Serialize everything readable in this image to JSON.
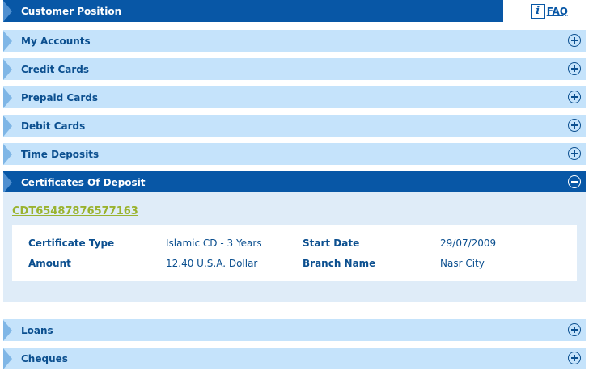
{
  "header": {
    "title": "Customer Position",
    "faq_icon": "info-i-icon",
    "faq_label": "FAQ"
  },
  "sections": [
    {
      "label": "My Accounts",
      "state": "collapsed"
    },
    {
      "label": "Credit Cards",
      "state": "collapsed"
    },
    {
      "label": "Prepaid Cards",
      "state": "collapsed"
    },
    {
      "label": "Debit Cards",
      "state": "collapsed"
    },
    {
      "label": "Time Deposits",
      "state": "collapsed"
    },
    {
      "label": "Certificates Of Deposit",
      "state": "expanded"
    },
    {
      "label": "Loans",
      "state": "collapsed"
    },
    {
      "label": "Cheques",
      "state": "collapsed"
    }
  ],
  "certificate": {
    "id": "CDT65487876577163",
    "fields": {
      "type_label": "Certificate Type",
      "type_value": "Islamic CD - 3 Years",
      "start_label": "Start Date",
      "start_value": "29/07/2009",
      "amount_label": "Amount",
      "amount_value": "12.40 U.S.A. Dollar",
      "branch_label": "Branch Name",
      "branch_value": "Nasr City"
    }
  },
  "colors": {
    "dark_bar": "#0857a6",
    "light_bar": "#c5e3fb",
    "panel": "#dfecf8",
    "link": "#9ab32f"
  }
}
